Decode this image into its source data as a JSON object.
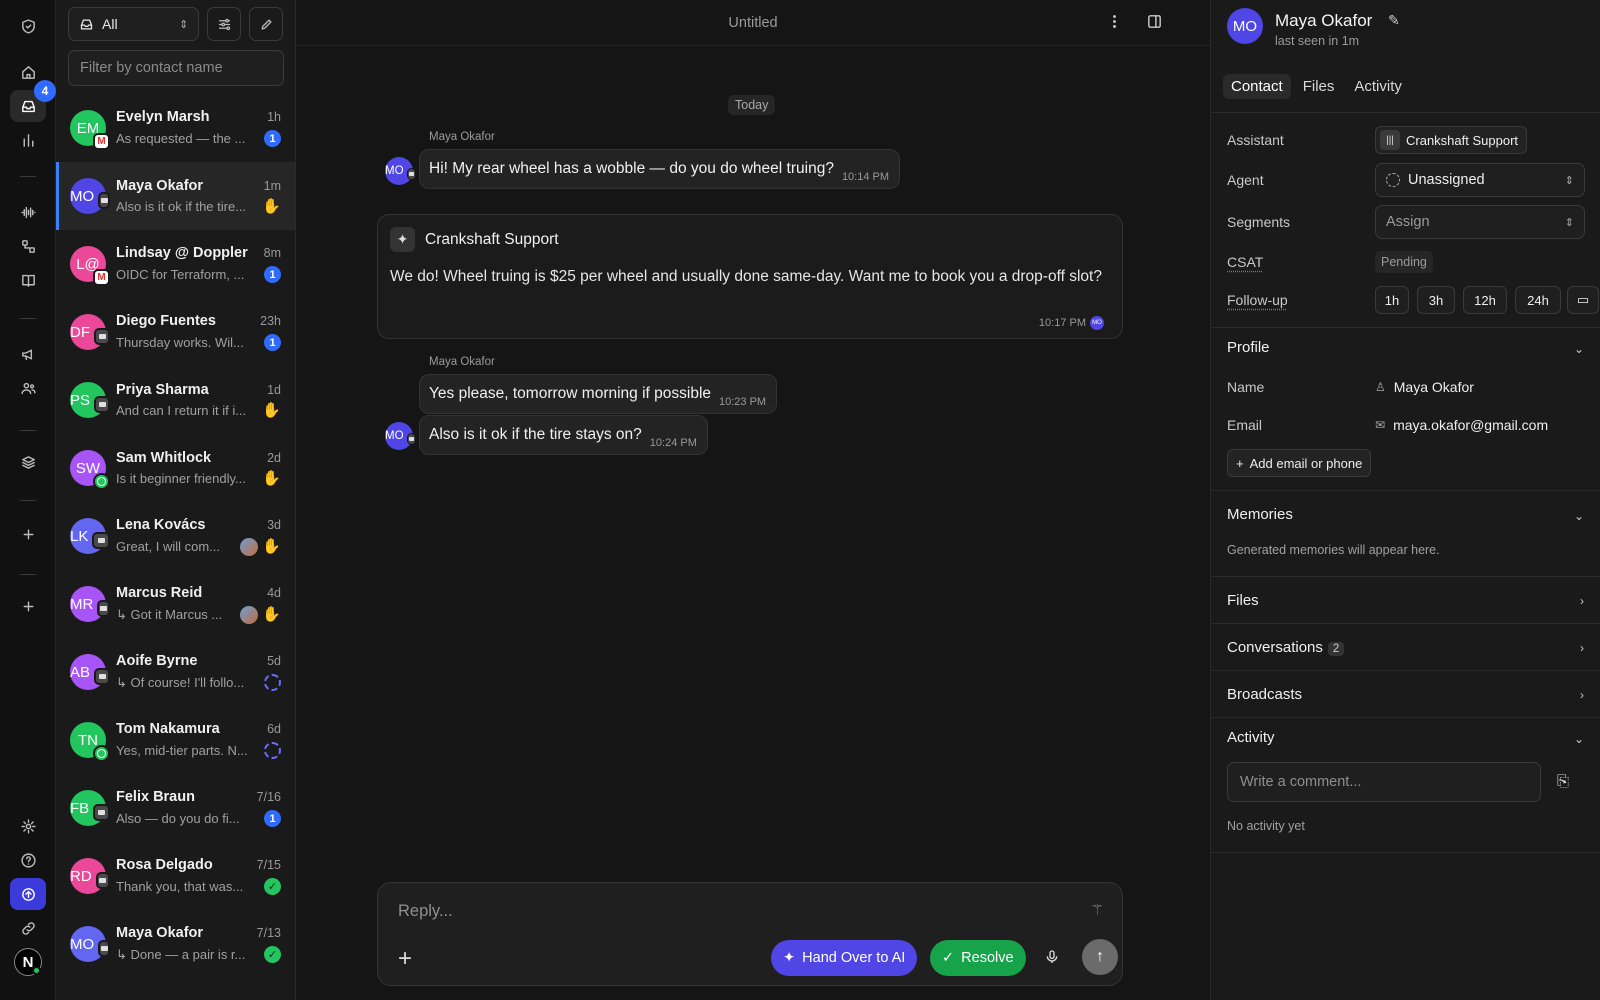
{
  "rail": {
    "inbox_badge": "4",
    "user_initial": "N"
  },
  "list": {
    "filter_label": "All",
    "search_placeholder": "Filter by contact name",
    "conversations": [
      {
        "initials": "EM",
        "name": "Evelyn Marsh",
        "time": "1h",
        "preview": "As requested — the ...",
        "color": "#22c55e",
        "channel": "mail",
        "indicators": [
          "count:1"
        ]
      },
      {
        "initials": "MO",
        "name": "Maya Okafor",
        "time": "1m",
        "preview": "Also is it ok if the tire...",
        "color": "#4f46e5",
        "channel": "chat",
        "indicators": [
          "hand"
        ],
        "active": true
      },
      {
        "initials": "L@",
        "name": "Lindsay @ Doppler",
        "time": "8m",
        "preview": "OIDC for Terraform, ...",
        "color": "#ec4899",
        "channel": "mail",
        "indicators": [
          "count:1"
        ]
      },
      {
        "initials": "DF",
        "name": "Diego Fuentes",
        "time": "23h",
        "preview": "Thursday works. Wil...",
        "color": "#ec4899",
        "channel": "chat",
        "indicators": [
          "count:1"
        ]
      },
      {
        "initials": "PS",
        "name": "Priya Sharma",
        "time": "1d",
        "preview": "And can I return it if i...",
        "color": "#22c55e",
        "channel": "chat",
        "indicators": [
          "hand"
        ]
      },
      {
        "initials": "SW",
        "name": "Sam Whitlock",
        "time": "2d",
        "preview": "Is it beginner friendly...",
        "color": "#a855f7",
        "channel": "wa",
        "indicators": [
          "hand"
        ]
      },
      {
        "initials": "LK",
        "name": "Lena Kovács",
        "time": "3d",
        "preview": "Great, I will com...",
        "color": "#6366f1",
        "channel": "chat",
        "indicators": [
          "agent",
          "hand"
        ]
      },
      {
        "initials": "MR",
        "name": "Marcus Reid",
        "time": "4d",
        "preview": "↳ Got it Marcus ...",
        "color": "#a855f7",
        "channel": "chat",
        "indicators": [
          "agent",
          "hand"
        ]
      },
      {
        "initials": "AB",
        "name": "Aoife Byrne",
        "time": "5d",
        "preview": "↳ Of course! I'll follo...",
        "color": "#a855f7",
        "channel": "chat",
        "indicators": [
          "snooze"
        ]
      },
      {
        "initials": "TN",
        "name": "Tom Nakamura",
        "time": "6d",
        "preview": "Yes, mid-tier parts. N...",
        "color": "#22c55e",
        "channel": "wa",
        "indicators": [
          "snooze"
        ]
      },
      {
        "initials": "FB",
        "name": "Felix Braun",
        "time": "7/16",
        "preview": "Also — do you do fi...",
        "color": "#22c55e",
        "channel": "chat",
        "indicators": [
          "count:1"
        ]
      },
      {
        "initials": "RD",
        "name": "Rosa Delgado",
        "time": "7/15",
        "preview": "Thank you, that was...",
        "color": "#ec4899",
        "channel": "chat",
        "indicators": [
          "ok"
        ]
      },
      {
        "initials": "MO",
        "name": "Maya Okafor",
        "time": "7/13",
        "preview": "↳ Done — a pair is r...",
        "color": "#6366f1",
        "channel": "chat",
        "indicators": [
          "ok"
        ]
      }
    ]
  },
  "chat": {
    "title": "Untitled",
    "day_label": "Today",
    "msg1": {
      "sender": "Maya Okafor",
      "text": "Hi! My rear wheel has a wobble — do you do wheel truing?",
      "time": "10:14 PM",
      "avatar": "MO"
    },
    "ai": {
      "name": "Crankshaft Support",
      "text": "We do! Wheel truing is $25 per wheel and usually done same-day. Want me to book you a drop-off slot?",
      "time": "10:17 PM",
      "avatar": "MO"
    },
    "msg2": {
      "sender": "Maya Okafor",
      "text": "Yes please, tomorrow morning if possible",
      "time": "10:23 PM"
    },
    "msg3": {
      "text": "Also is it ok if the tire stays on?",
      "time": "10:24 PM",
      "avatar": "MO"
    },
    "composer": {
      "placeholder": "Reply...",
      "handover_label": "Hand Over to AI",
      "resolve_label": "Resolve"
    }
  },
  "contact": {
    "initials": "MO",
    "name": "Maya Okafor",
    "last_seen": "last seen in 1m",
    "tabs": [
      "Contact",
      "Files",
      "Activity"
    ],
    "assistant_label": "Assistant",
    "assistant_value": "Crankshaft Support",
    "agent_label": "Agent",
    "agent_value": "Unassigned",
    "segments_label": "Segments",
    "segments_value": "Assign",
    "csat_label": "CSAT",
    "csat_value": "Pending",
    "followup_label": "Follow-up",
    "followup_options": [
      "1h",
      "3h",
      "12h",
      "24h"
    ],
    "profile_title": "Profile",
    "name_label": "Name",
    "name_value": "Maya Okafor",
    "email_label": "Email",
    "email_value": "maya.okafor@gmail.com",
    "add_label": "Add email or phone",
    "memories_title": "Memories",
    "memories_empty": "Generated memories will appear here.",
    "files_title": "Files",
    "conversations_title": "Conversations",
    "conversations_count": "2",
    "broadcasts_title": "Broadcasts",
    "activity_title": "Activity",
    "comment_placeholder": "Write a comment...",
    "activity_empty": "No activity yet"
  }
}
